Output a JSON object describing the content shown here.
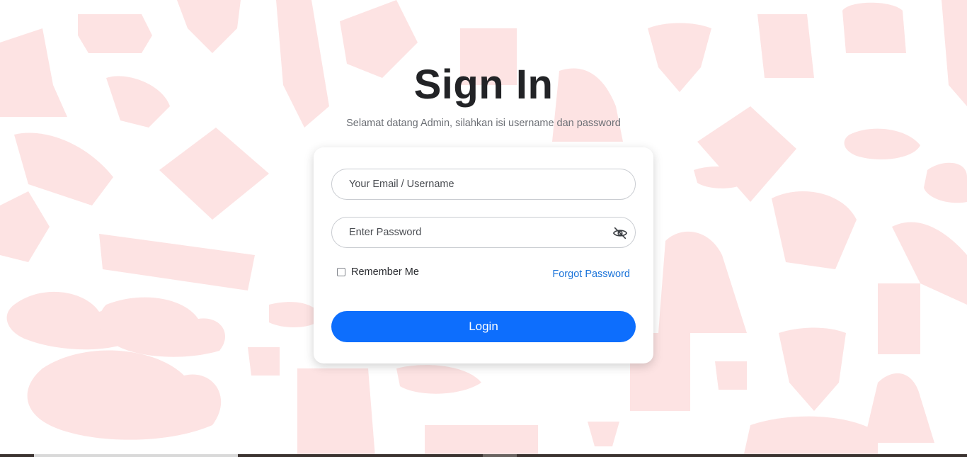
{
  "page": {
    "title": "Sign In",
    "subtitle": "Selamat datang Admin, silahkan isi username dan password"
  },
  "form": {
    "email_placeholder": "Your Email / Username",
    "password_placeholder": "Enter Password",
    "remember_label": "Remember Me",
    "forgot_label": "Forgot Password",
    "login_label": "Login"
  },
  "icons": {
    "password_toggle": "eye-off-icon"
  },
  "colors": {
    "primary": "#0d6efd",
    "link": "#1a73d9",
    "pattern": "#fde3e3"
  }
}
